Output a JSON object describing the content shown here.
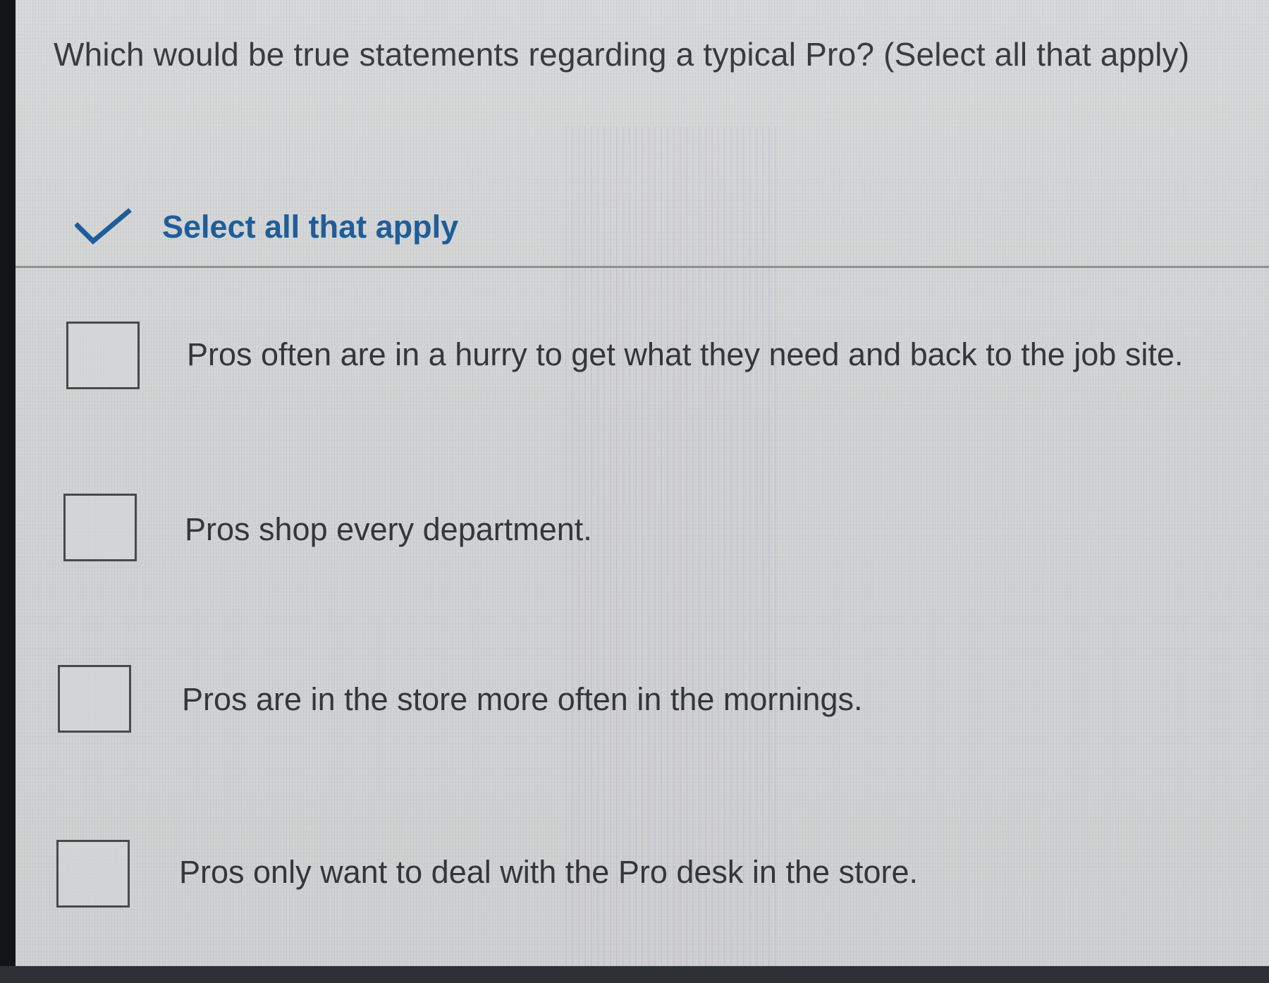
{
  "question": {
    "text": "Which would be true statements regarding a typical Pro? (Select all that apply)"
  },
  "instruction": {
    "label": "Select all that apply",
    "icon": "checkmark-icon",
    "color": "#1f5d99"
  },
  "options": [
    {
      "label": "Pros often are in a hurry to get what they need and back to the job site.",
      "checked": false
    },
    {
      "label": "Pros shop every department.",
      "checked": false
    },
    {
      "label": "Pros are in the store more often in the mornings.",
      "checked": false
    },
    {
      "label": "Pros only want to deal with the Pro desk in the store.",
      "checked": false
    }
  ],
  "colors": {
    "background": "#d3d5d6",
    "text": "#353638",
    "border": "#474a4d",
    "divider": "#8d8f91",
    "frame": "#16181b"
  }
}
